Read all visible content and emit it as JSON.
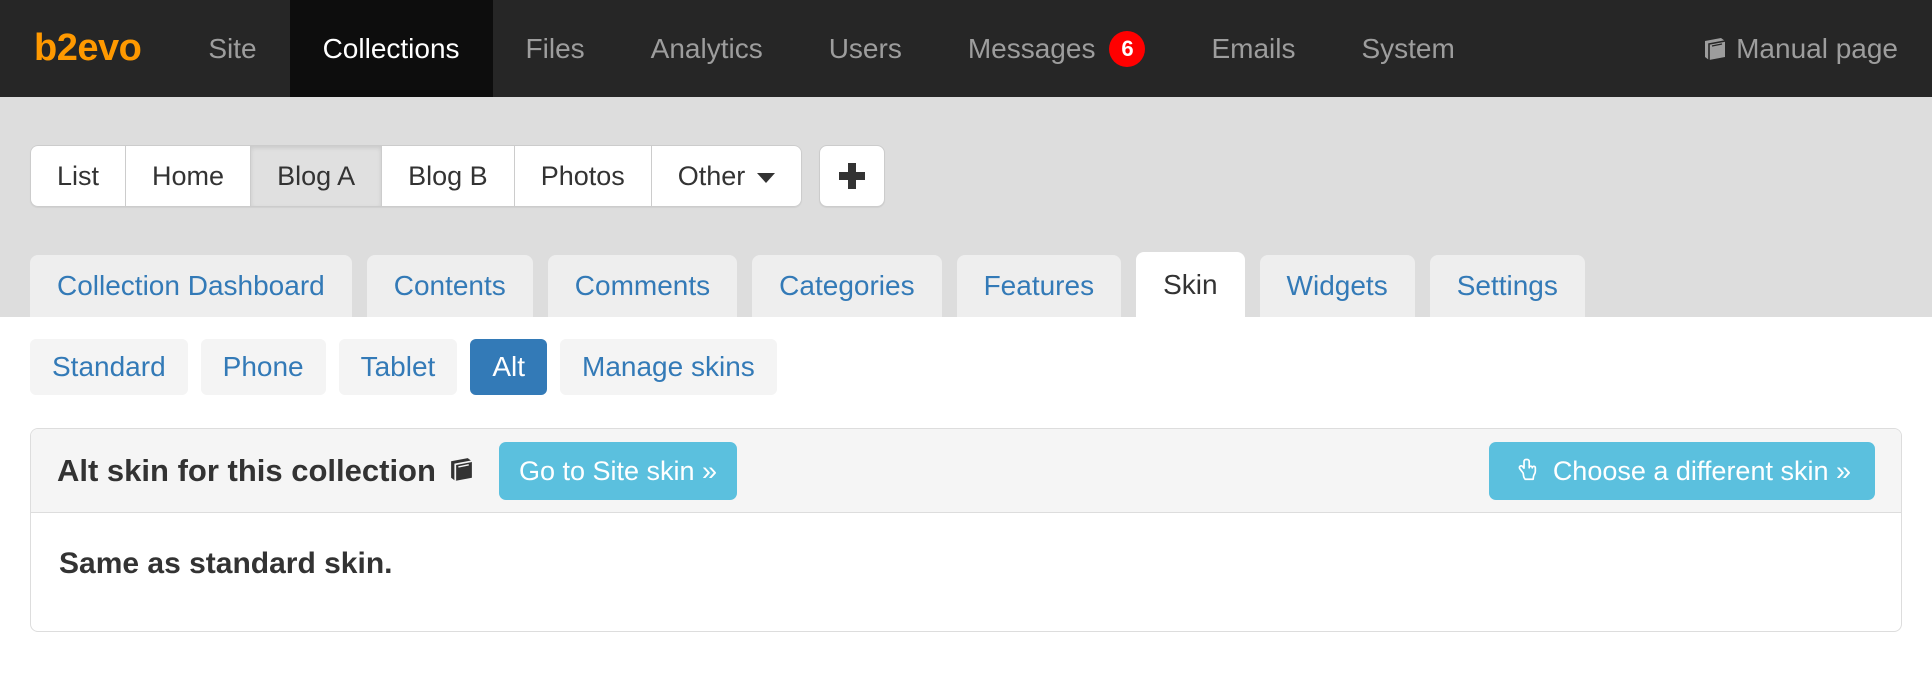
{
  "topnav": {
    "brand": "b2evo",
    "items": [
      {
        "label": "Site",
        "active": false
      },
      {
        "label": "Collections",
        "active": true
      },
      {
        "label": "Files",
        "active": false
      },
      {
        "label": "Analytics",
        "active": false
      },
      {
        "label": "Users",
        "active": false
      },
      {
        "label": "Messages",
        "active": false,
        "badge": "6"
      },
      {
        "label": "Emails",
        "active": false
      },
      {
        "label": "System",
        "active": false
      }
    ],
    "manual": {
      "label": "Manual page",
      "icon": "book-icon"
    }
  },
  "collections": {
    "buttons": [
      {
        "label": "List",
        "active": false
      },
      {
        "label": "Home",
        "active": false
      },
      {
        "label": "Blog A",
        "active": true
      },
      {
        "label": "Blog B",
        "active": false
      },
      {
        "label": "Photos",
        "active": false
      },
      {
        "label": "Other",
        "active": false,
        "caret": true
      }
    ],
    "add_button": {
      "icon": "plus-icon",
      "label": "+"
    }
  },
  "subtabs": [
    {
      "label": "Collection Dashboard",
      "active": false
    },
    {
      "label": "Contents",
      "active": false
    },
    {
      "label": "Comments",
      "active": false
    },
    {
      "label": "Categories",
      "active": false
    },
    {
      "label": "Features",
      "active": false
    },
    {
      "label": "Skin",
      "active": true
    },
    {
      "label": "Widgets",
      "active": false
    },
    {
      "label": "Settings",
      "active": false
    }
  ],
  "skin_tabs": [
    {
      "label": "Standard",
      "active": false
    },
    {
      "label": "Phone",
      "active": false
    },
    {
      "label": "Tablet",
      "active": false
    },
    {
      "label": "Alt",
      "active": true
    },
    {
      "label": "Manage skins",
      "active": false
    }
  ],
  "panel": {
    "title": "Alt skin for this collection",
    "title_icon": "book-icon",
    "go_to_site_skin": "Go to Site skin »",
    "choose_skin": "Choose a different skin »",
    "choose_skin_icon": "pointing-hand-icon",
    "body_text": "Same as standard skin."
  },
  "colors": {
    "navbar_bg": "#262626",
    "navbar_active_bg": "#0d0d0d",
    "brand": "#ff9900",
    "badge_red": "#ff0000",
    "band_bg": "#dddddd",
    "link_blue": "#337ab7",
    "info_blue": "#5bc0de",
    "tab_bg": "#eeeeee",
    "panel_head_bg": "#f5f5f5"
  }
}
